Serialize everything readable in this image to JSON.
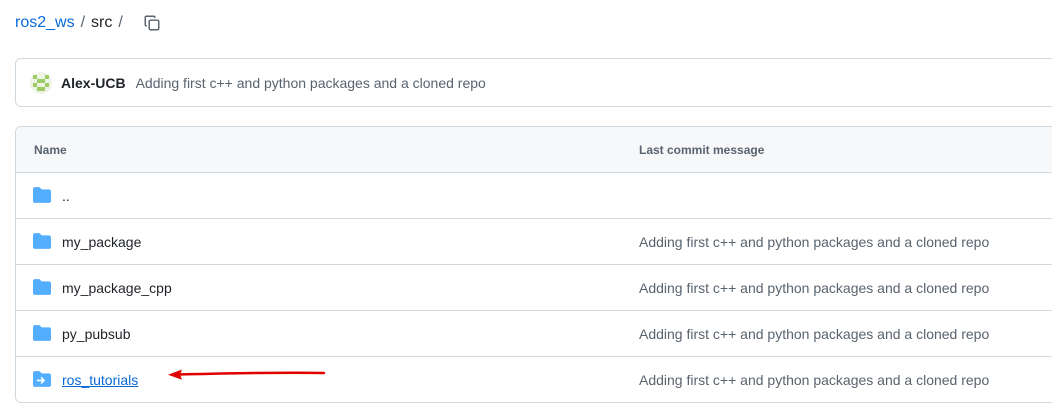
{
  "breadcrumb": {
    "repo": "ros2_ws",
    "separator": "/",
    "current": "src",
    "trailing_separator": "/"
  },
  "commit": {
    "author": "Alex-UCB",
    "message": "Adding first c++ and python packages and a cloned repo"
  },
  "table": {
    "headers": {
      "name": "Name",
      "message": "Last commit message"
    },
    "rows": [
      {
        "name": "..",
        "message": "",
        "icon": "folder-icon"
      },
      {
        "name": "my_package",
        "message": "Adding first c++ and python packages and a cloned repo",
        "icon": "folder-icon"
      },
      {
        "name": "my_package_cpp",
        "message": "Adding first c++ and python packages and a cloned repo",
        "icon": "folder-icon"
      },
      {
        "name": "py_pubsub",
        "message": "Adding first c++ and python packages and a cloned repo",
        "icon": "folder-icon"
      },
      {
        "name": "ros_tutorials",
        "message": "Adding first c++ and python packages and a cloned repo",
        "icon": "submodule-icon"
      }
    ]
  },
  "colors": {
    "link": "#0969da",
    "folder": "#54aeff",
    "annotation_arrow": "#e00000"
  }
}
